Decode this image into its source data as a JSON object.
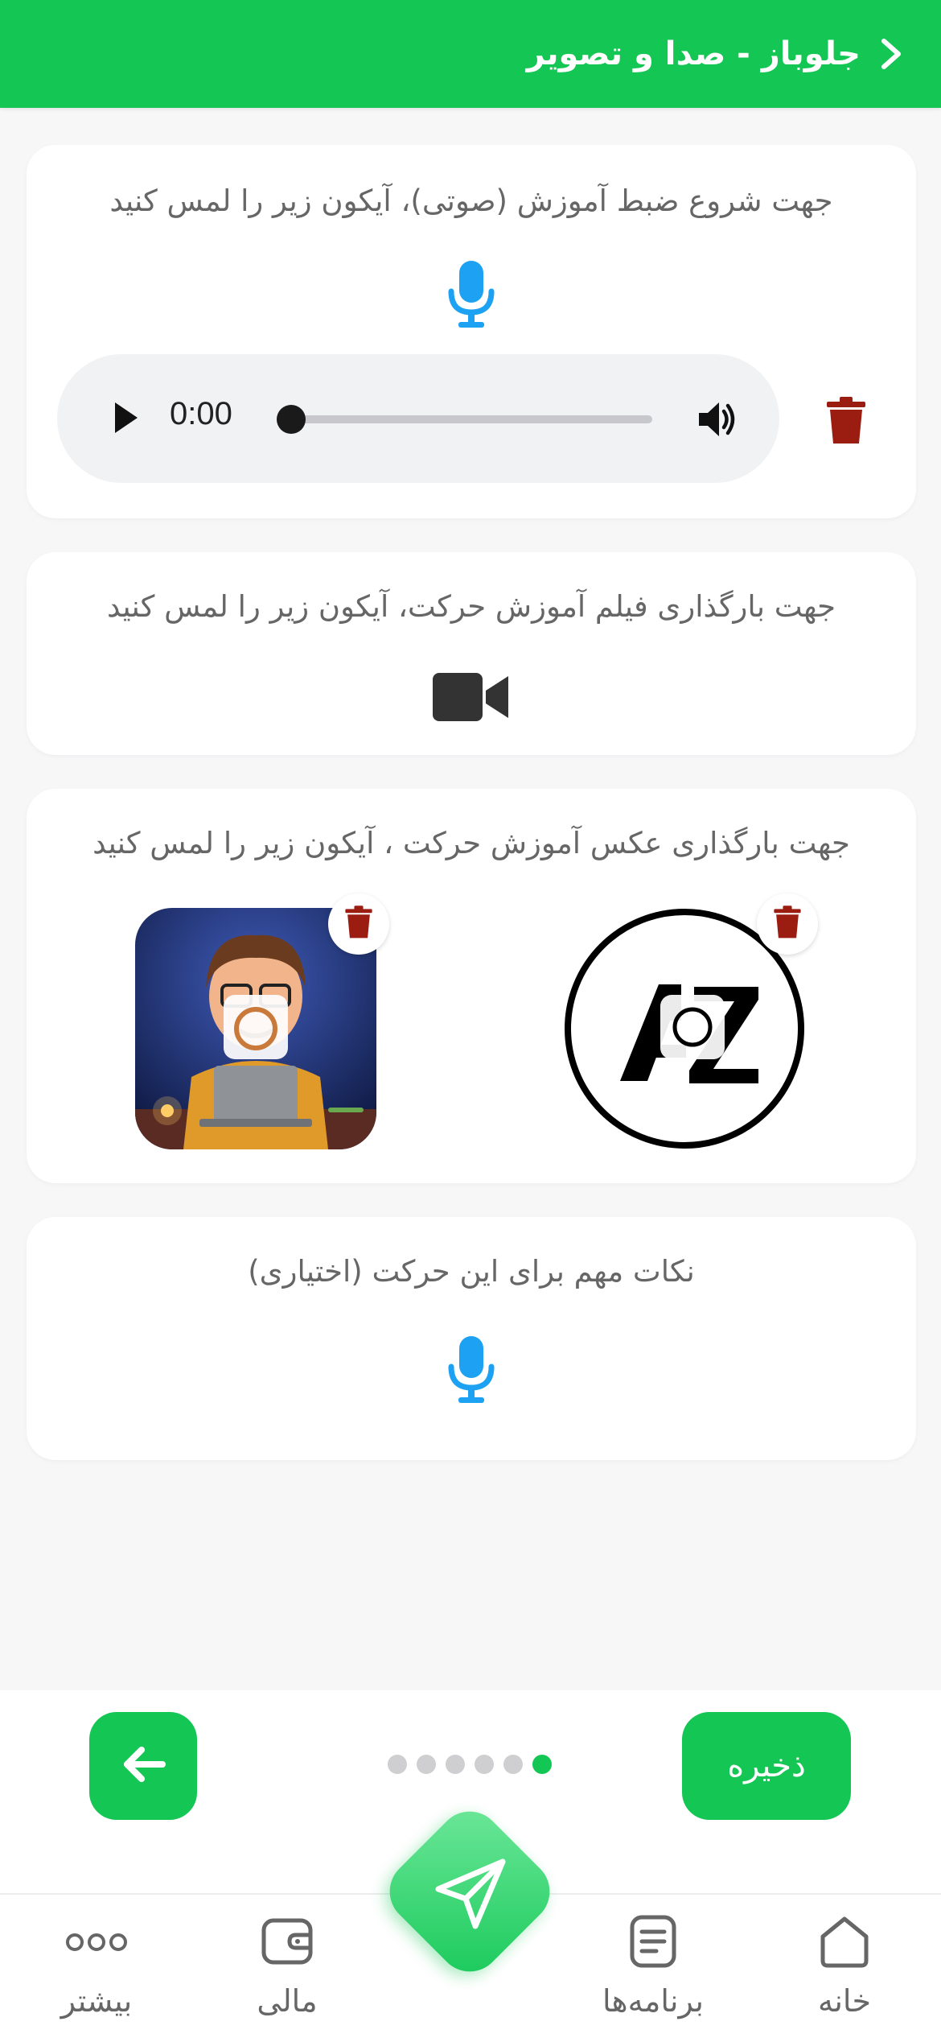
{
  "header": {
    "title": "جلوباز - صدا و تصویر",
    "back_icon": "chevron-right-icon"
  },
  "sections": {
    "audio": {
      "title": "جهت شروع ضبط آموزش (صوتی)، آیکون زیر را لمس کنید",
      "icon": "microphone-icon",
      "player": {
        "time": "0:00",
        "progress": 0
      }
    },
    "video": {
      "title": "جهت بارگذاری فیلم آموزش حرکت، آیکون زیر را لمس کنید",
      "icon": "video-camera-icon"
    },
    "photo": {
      "title": "جهت بارگذاری عکس آموزش حرکت ، آیکون زیر را لمس کنید",
      "thumbnails": [
        {
          "subject": "logo-az-thumbnail"
        },
        {
          "subject": "cartoon-avatar-thumbnail"
        }
      ]
    },
    "notes": {
      "title": "نکات مهم برای این حرکت (اختیاری)",
      "icon": "microphone-icon"
    }
  },
  "footer": {
    "save_label": "ذخیره",
    "back_icon": "arrow-left-icon",
    "step_count": 6,
    "active_step": 6
  },
  "tabbar": {
    "items": [
      {
        "label": "خانه",
        "icon": "home-icon"
      },
      {
        "label": "برنامه‌ها",
        "icon": "document-icon"
      },
      {
        "label": "مالی",
        "icon": "wallet-icon"
      },
      {
        "label": "بیشتر",
        "icon": "more-dots-icon"
      }
    ],
    "fab_icon": "send-icon"
  },
  "colors": {
    "primary": "#14c653",
    "mic_blue": "#1da1f2",
    "delete_red": "#9b1c10",
    "background": "#f7f7f8"
  }
}
